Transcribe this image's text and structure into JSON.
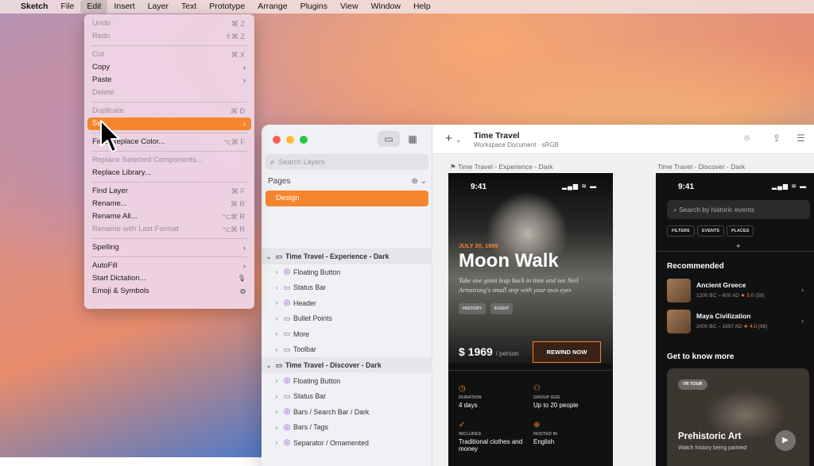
{
  "colors": {
    "accent": "#f5862d",
    "symbol": "#a24bd0"
  },
  "menubar": {
    "apple": "",
    "items": [
      "Sketch",
      "File",
      "Edit",
      "Insert",
      "Layer",
      "Text",
      "Prototype",
      "Arrange",
      "Plugins",
      "View",
      "Window",
      "Help"
    ],
    "active": "Edit"
  },
  "edit_menu": {
    "items": [
      {
        "label": "Undo",
        "shortcut": "⌘ Z",
        "disabled": true
      },
      {
        "label": "Redo",
        "shortcut": "⇧⌘ Z",
        "disabled": true
      },
      {
        "sep": true
      },
      {
        "label": "Cut",
        "shortcut": "⌘ X",
        "disabled": true
      },
      {
        "label": "Copy",
        "submenu": true
      },
      {
        "label": "Paste",
        "submenu": true
      },
      {
        "label": "Delete",
        "disabled": true
      },
      {
        "sep": true
      },
      {
        "label": "Duplicate",
        "shortcut": "⌘ D",
        "disabled": true
      },
      {
        "label": "Se",
        "submenu": true,
        "highlighted": true
      },
      {
        "sep": true
      },
      {
        "label": "Fin   d Replace Color...",
        "shortcut": "⌥⌘ F"
      },
      {
        "sep": true
      },
      {
        "label": "Replace Selected Components...",
        "disabled": true
      },
      {
        "label": "Replace Library..."
      },
      {
        "sep": true
      },
      {
        "label": "Find Layer",
        "shortcut": "⌘ F"
      },
      {
        "label": "Rename...",
        "shortcut": "⌘ R"
      },
      {
        "label": "Rename All...",
        "shortcut": "⌥⌘ R"
      },
      {
        "label": "Rename with Last Format",
        "shortcut": "⌥⌘ R",
        "disabled": true
      },
      {
        "sep": true
      },
      {
        "label": "Spelling",
        "submenu": true
      },
      {
        "sep": true
      },
      {
        "label": "AutoFill",
        "submenu": true
      },
      {
        "label": "Start Dictation...",
        "icon": "mic-icon"
      },
      {
        "label": "Emoji & Symbols",
        "icon": "globe-icon"
      }
    ]
  },
  "sidebar": {
    "search_placeholder": "Search Layers",
    "pages_label": "Pages",
    "pages": [
      "Design"
    ],
    "layers": [
      {
        "label": "Time Travel - Experience - Dark",
        "group": true
      },
      {
        "label": "Floating Button",
        "kind": "symbol"
      },
      {
        "label": "Status Bar",
        "kind": "folder"
      },
      {
        "label": "Header",
        "kind": "symbol"
      },
      {
        "label": "Bullet Points",
        "kind": "folder"
      },
      {
        "label": "More",
        "kind": "folder"
      },
      {
        "label": "Toolbar",
        "kind": "folder"
      },
      {
        "label": "Time Travel - Discover - Dark",
        "group": true
      },
      {
        "label": "Floating Button",
        "kind": "symbol"
      },
      {
        "label": "Status Bar",
        "kind": "folder"
      },
      {
        "label": "Bars / Search Bar / Dark",
        "kind": "symbol"
      },
      {
        "label": "Bars / Tags",
        "kind": "symbol"
      },
      {
        "label": "Separator / Ornamented",
        "kind": "symbol"
      }
    ]
  },
  "toolbar": {
    "plus": "+",
    "title": "Time Travel",
    "subtitle": "Workspace Document · sRGB"
  },
  "artboard1": {
    "label": "Time Travel - Experience - Dark",
    "time": "9:41",
    "date": "JULY 20, 1969",
    "title": "Moon Walk",
    "quote": "Take one giant leap back in time and see Neil Armstrong's small step with your own eyes",
    "chips": [
      "HISTORY",
      "EVENT"
    ],
    "price": "$ 1969",
    "per": "/ person",
    "cta": "REWIND NOW",
    "info": [
      {
        "label": "DURATION",
        "value": "4 days"
      },
      {
        "label": "GROUP SIZE",
        "value": "Up to 20 people"
      },
      {
        "label": "INCLUDES",
        "value": "Traditional clothes and money"
      },
      {
        "label": "HOSTED IN",
        "value": "English"
      }
    ]
  },
  "artboard2": {
    "label": "Time Travel - Discover - Dark",
    "time": "9:41",
    "search_placeholder": "Search by historic events",
    "filters": [
      "FILTERS",
      "EVENTS",
      "PLACES"
    ],
    "recommended": "Recommended",
    "items": [
      {
        "name": "Ancient Greece",
        "dates": "1200 BC – 600 AD",
        "rating": "5.0",
        "count": "(59)"
      },
      {
        "name": "Maya Civilization",
        "dates": "2000 BC – 1697 AD",
        "rating": "4.0",
        "count": "(98)"
      }
    ],
    "get_to_know": "Get to know more",
    "vr_chip": "VR TOUR",
    "vr_title": "Prehistoric Art",
    "vr_sub": "Watch history being painted"
  }
}
